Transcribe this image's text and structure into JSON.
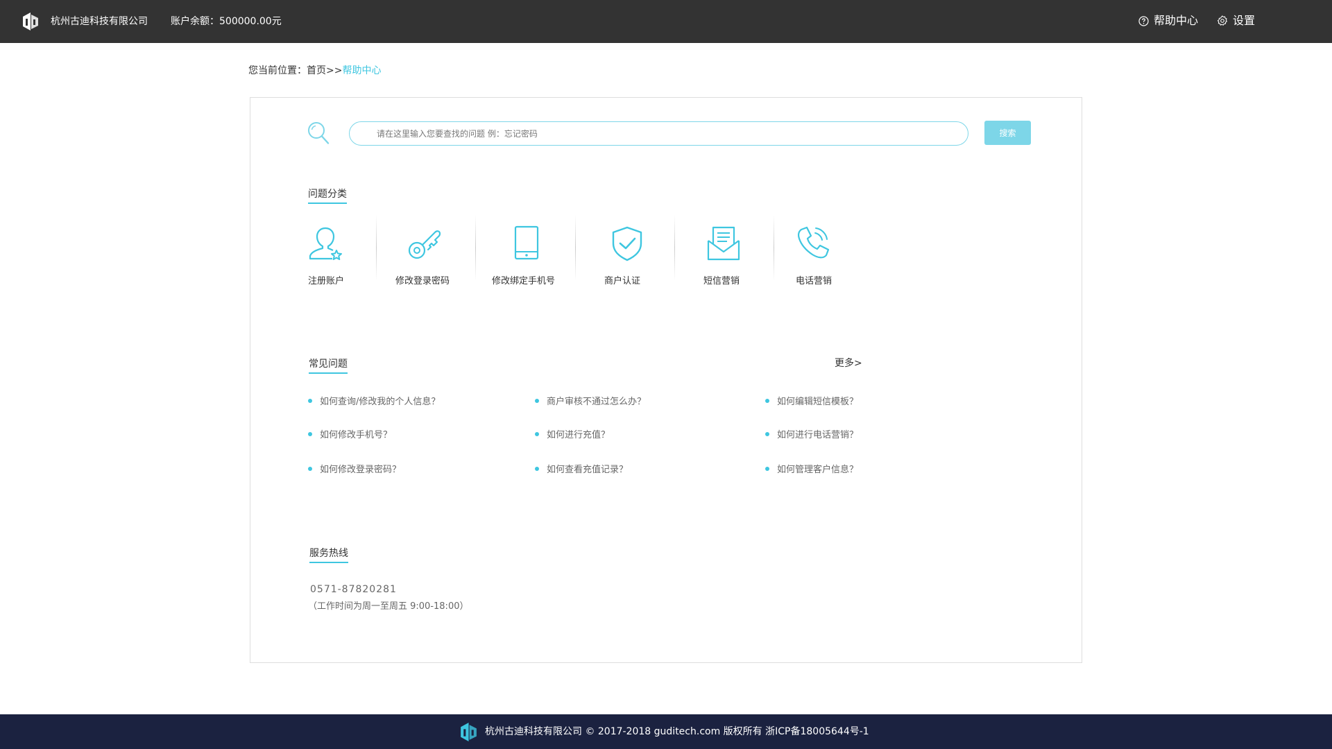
{
  "header": {
    "company_name": "杭州古迪科技有限公司",
    "balance": "账户余额：500000.00元",
    "help_center": "帮助中心",
    "settings": "设置"
  },
  "breadcrumb": {
    "prefix": "您当前位置：",
    "home": "首页",
    "separator": ">>",
    "current": "帮助中心"
  },
  "search": {
    "placeholder": "请在这里输入您要查找的问题 例：忘记密码",
    "button_label": "搜索"
  },
  "categories": {
    "title": "问题分类",
    "items": [
      {
        "label": "注册账户",
        "icon": "user-star-icon"
      },
      {
        "label": "修改登录密码",
        "icon": "key-icon"
      },
      {
        "label": "修改绑定手机号",
        "icon": "phone-device-icon"
      },
      {
        "label": "商户认证",
        "icon": "shield-check-icon"
      },
      {
        "label": "短信营销",
        "icon": "envelope-icon"
      },
      {
        "label": "电话营销",
        "icon": "telephone-icon"
      }
    ]
  },
  "faq": {
    "title": "常见问题",
    "more": "更多>",
    "items": [
      "如何查询/修改我的个人信息？",
      "商户审核不通过怎么办？",
      "如何编辑短信模板？",
      "如何修改手机号？",
      "如何进行充值？",
      "如何进行电话营销？",
      "如何修改登录密码？",
      "如何查看充值记录？",
      "如何管理客户信息？"
    ]
  },
  "hotline": {
    "title": "服务热线",
    "phone": "0571-87820281",
    "hours": "（工作时间为周一至周五 9:00-18:00）"
  },
  "footer": {
    "text": "杭州古迪科技有限公司 © 2017-2018 guditech.com 版权所有 浙ICP备18005644号-1"
  },
  "colors": {
    "accent": "#3ec6e0",
    "topbar": "#333333",
    "footer": "#1b2240",
    "search_button": "#7dd6e8"
  }
}
